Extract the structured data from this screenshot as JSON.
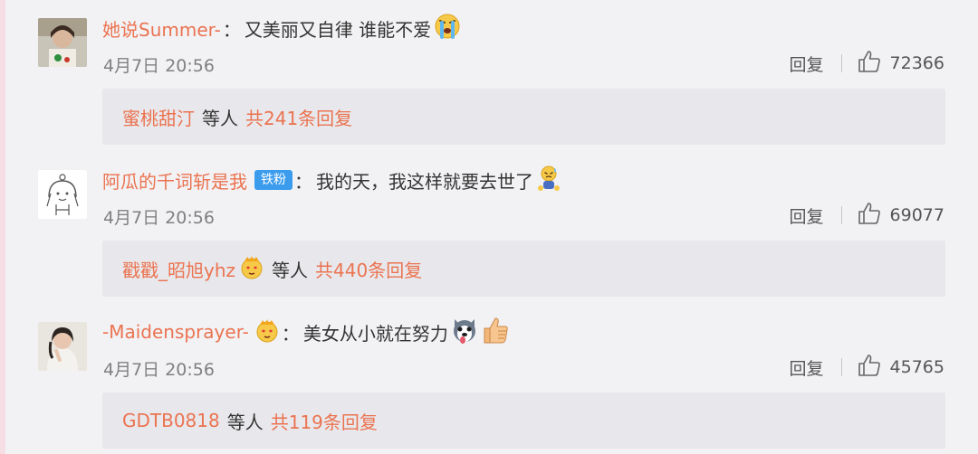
{
  "comments": [
    {
      "username": "她说Summer-",
      "text": "又美丽又自律 谁能不爱",
      "badge": "",
      "emoji": "crying-face",
      "time": "4月7日 20:56",
      "reply_label": "回复",
      "likes": "72366",
      "reply_user": "蜜桃甜汀",
      "reply_user_emoji": "",
      "reply_mid": "等人",
      "reply_total": "共241条回复"
    },
    {
      "username": "阿瓜的千词斩是我",
      "text": "我的天，我这样就要去世了",
      "badge": "铁粉",
      "emoji": "sweat-face",
      "time": "4月7日 20:56",
      "reply_label": "回复",
      "likes": "69077",
      "reply_user": "戳戳_昭旭yhz",
      "reply_user_emoji": "crown-face",
      "reply_mid": "等人",
      "reply_total": "共440条回复"
    },
    {
      "username": "-Maidensprayer-",
      "text": "美女从小就在努力",
      "badge": "",
      "emoji": "husky-thumbs-up",
      "time": "4月7日 20:56",
      "reply_label": "回复",
      "likes": "45765",
      "reply_user": "GDTB0818",
      "reply_user_emoji": "",
      "reply_mid": "等人",
      "reply_total": "共119条回复"
    }
  ],
  "colors": {
    "username": "#eb7350",
    "badge": "#3b9cee",
    "background": "#f2f2f5",
    "reply_box": "#e8e8ec"
  }
}
